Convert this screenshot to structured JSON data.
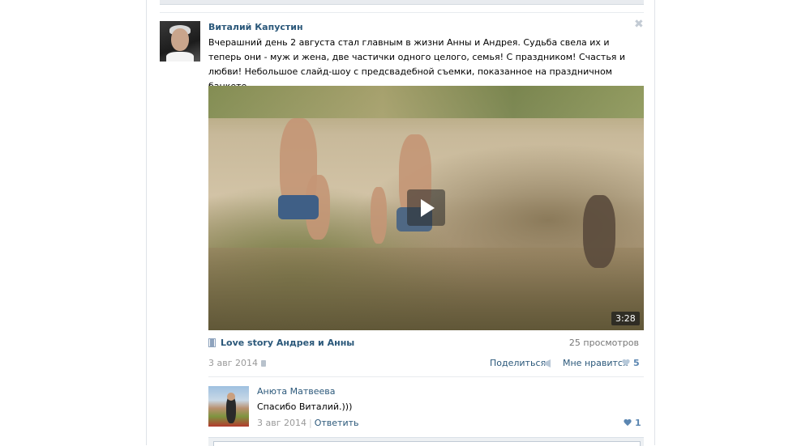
{
  "post": {
    "author": "Виталий Капустин",
    "text": "Вчерашний день 2 августа стал главным в жизни Анны и Андрея. Судьба свела их и теперь они - муж и жена, две частички одного целого, семья! С праздником! Счастья и любви! Небольшое слайд-шоу с предсвадебной съемки, показанное на праздничном банкете",
    "close_glyph": "✖",
    "video": {
      "duration": "3:28",
      "title": "Love story Андрея и Анны",
      "views": "25 просмотров"
    },
    "date": "3 авг 2014",
    "share_label": "Поделиться",
    "like_label": "Мне нравится",
    "like_count": "5"
  },
  "comment": {
    "author": "Анюта Матвеева",
    "text": "Спасибо Виталий.)))",
    "date": "3 авг 2014",
    "separator": "|",
    "reply_label": "Ответить",
    "like_count": "1"
  },
  "colors": {
    "link": "#2b587a",
    "muted": "#999999",
    "like_accent": "#5b86b1"
  }
}
